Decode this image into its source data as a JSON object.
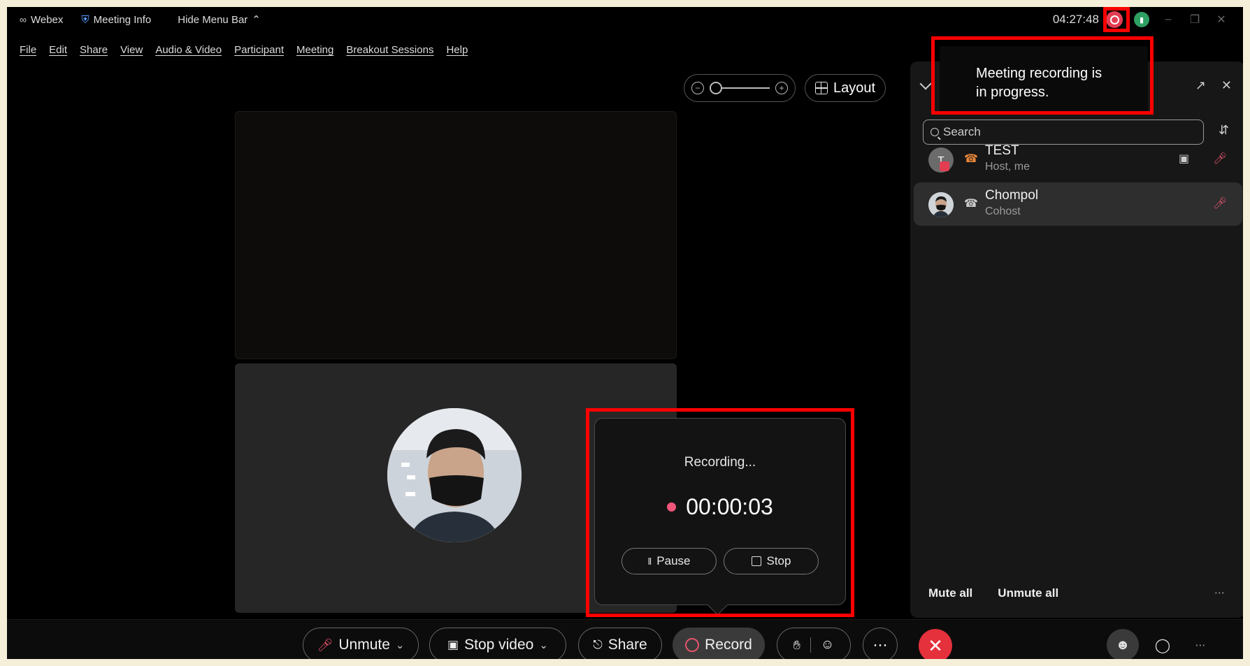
{
  "titlebar": {
    "app_name": "Webex",
    "meeting_info": "Meeting Info",
    "hide_menu": "Hide Menu Bar",
    "clock": "04:27:48"
  },
  "menu": [
    "File",
    "Edit",
    "Share",
    "View",
    "Audio & Video",
    "Participant",
    "Meeting",
    "Breakout Sessions",
    "Help"
  ],
  "view_controls": {
    "layout_label": "Layout"
  },
  "tooltip": {
    "line1": "Meeting recording is",
    "line2": "in progress."
  },
  "participants_panel": {
    "search_placeholder": "Search",
    "participants": [
      {
        "initial": "T",
        "name": "TEST",
        "role": "Host, me"
      },
      {
        "name": "Chompol",
        "role": "Cohost"
      }
    ],
    "mute_all": "Mute all",
    "unmute_all": "Unmute all"
  },
  "recording_popup": {
    "status": "Recording...",
    "elapsed": "00:00:03",
    "pause_label": "Pause",
    "stop_label": "Stop"
  },
  "controls": {
    "unmute": "Unmute",
    "stop_video": "Stop video",
    "share": "Share",
    "record": "Record"
  },
  "colors": {
    "recording_red": "#e33d52",
    "end_call_red": "#e5313c",
    "annotation_red": "#ff0000",
    "panel_bg": "#171717"
  }
}
